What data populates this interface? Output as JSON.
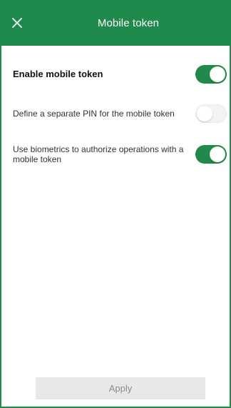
{
  "header": {
    "title": "Mobile token",
    "close_icon": "close-icon"
  },
  "settings": [
    {
      "label": "Enable mobile token",
      "enabled": true
    },
    {
      "label": "Define a separate PIN for the mobile token",
      "enabled": false
    },
    {
      "label": "Use biometrics to authorize operations with a mobile token",
      "enabled": true
    }
  ],
  "footer": {
    "apply_label": "Apply"
  },
  "colors": {
    "brand_green": "#1f8a4c",
    "toggle_off": "#f3f3f3",
    "button_disabled_bg": "#e8e8e8",
    "button_disabled_text": "#8c8c8c"
  }
}
